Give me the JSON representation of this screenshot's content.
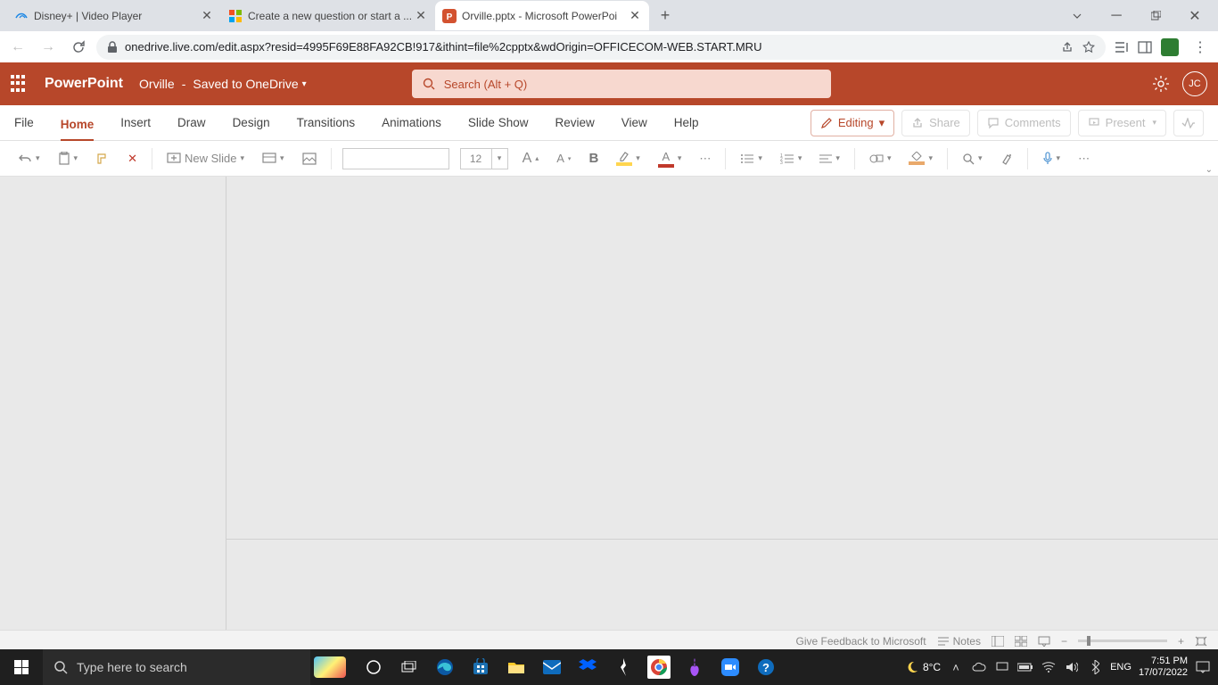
{
  "browser": {
    "tabs": [
      {
        "title": "Disney+ | Video Player",
        "icon_color": "#1e88e5"
      },
      {
        "title": "Create a new question or start a ...",
        "icon_color": "#f25022"
      },
      {
        "title": "Orville.pptx - Microsoft PowerPoi",
        "icon_color": "#d35230"
      }
    ],
    "url": "onedrive.live.com/edit.aspx?resid=4995F69E88FA92CB!917&ithint=file%2cpptx&wdOrigin=OFFICECOM-WEB.START.MRU"
  },
  "app": {
    "name": "PowerPoint",
    "doc_name": "Orville",
    "saved_text": "Saved to OneDrive",
    "search_placeholder": "Search (Alt + Q)",
    "user_initials": "JC"
  },
  "ribbon": {
    "tabs": [
      "File",
      "Home",
      "Insert",
      "Draw",
      "Design",
      "Transitions",
      "Animations",
      "Slide Show",
      "Review",
      "View",
      "Help"
    ],
    "mode_label": "Editing",
    "share": "Share",
    "comments": "Comments",
    "present": "Present"
  },
  "toolbar": {
    "new_slide": "New Slide",
    "font_size": "12"
  },
  "status": {
    "feedback": "Give Feedback to Microsoft",
    "notes": "Notes"
  },
  "taskbar": {
    "search_placeholder": "Type here to search",
    "weather": "8°C",
    "lang": "ENG",
    "time": "7:51 PM",
    "date": "17/07/2022"
  }
}
